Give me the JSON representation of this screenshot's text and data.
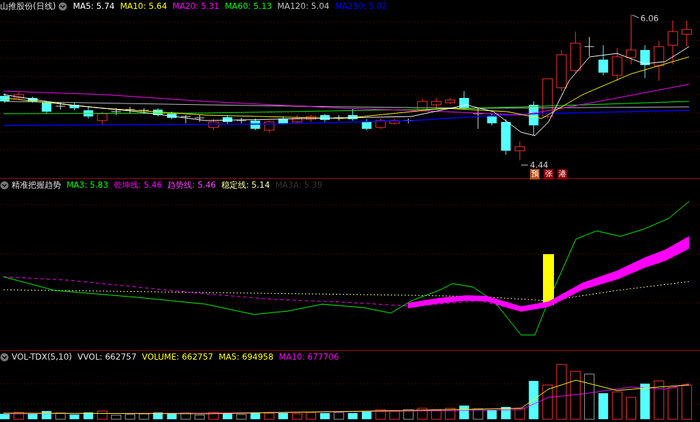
{
  "price_panel": {
    "title": "山推股份(日线)",
    "legend": [
      {
        "text": "MA5: 5.74",
        "color": "#ffffff"
      },
      {
        "text": "MA10: 5.64",
        "color": "#ffff00"
      },
      {
        "text": "MA20: 5.31",
        "color": "#ff00ff"
      },
      {
        "text": "MA60: 5.13",
        "color": "#00ff00"
      },
      {
        "text": "MA120: 5.04",
        "color": "#c0c0c0"
      },
      {
        "text": "MA250: 5.02",
        "color": "#0000ff"
      }
    ],
    "high_label": "6.06",
    "low_label": "4.44",
    "badges": [
      {
        "text": "预",
        "color": "#b5501a"
      },
      {
        "text": "张",
        "color": "#8b0000"
      },
      {
        "text": "港",
        "color": "#8b0000"
      }
    ]
  },
  "trend_panel": {
    "title": "精准把握趋势",
    "legend": [
      {
        "text": "MA3: 5.83",
        "color": "#00ff00"
      },
      {
        "text": "乾坤线: 5.46",
        "color": "#ff00ff"
      },
      {
        "text": "趋势线: 5.46",
        "color": "#ff44ff"
      },
      {
        "text": "稳定线: 5.14",
        "color": "#ffff99"
      },
      {
        "text": "MA3A: 5.39",
        "color": "#333333"
      }
    ]
  },
  "volume_panel": {
    "title": "VOL-TDX(5,10)",
    "legend": [
      {
        "text": "VVOL: 662757",
        "color": "#e0e0e0"
      },
      {
        "text": "VOLUME: 662757",
        "color": "#ffff00"
      },
      {
        "text": "MA5: 694958",
        "color": "#ffff00"
      },
      {
        "text": "MA10: 677706",
        "color": "#ff00ff"
      }
    ]
  }
}
